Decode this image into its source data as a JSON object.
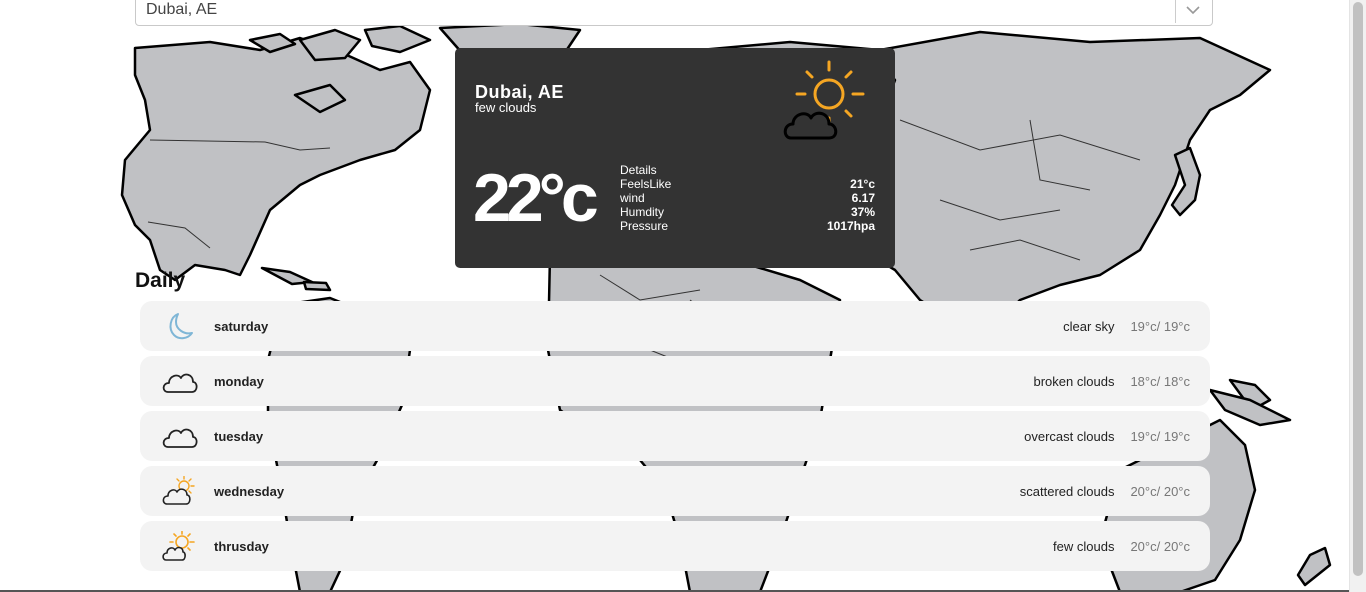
{
  "search": {
    "value": "Dubai, AE"
  },
  "current": {
    "city": "Dubai, AE",
    "description": "few clouds",
    "temperature": "22°c",
    "icon": "sun-cloud-icon",
    "details_label": "Details",
    "details": [
      {
        "label": "FeelsLike",
        "value": "21°c"
      },
      {
        "label": "wind",
        "value": "6.17"
      },
      {
        "label": "Humdity",
        "value": "37%"
      },
      {
        "label": "Pressure",
        "value": "1017hpa"
      }
    ]
  },
  "daily_title": "Daily",
  "daily": [
    {
      "day": "saturday",
      "description": "clear sky",
      "range": "19°c/ 19°c",
      "icon": "moon-icon"
    },
    {
      "day": "monday",
      "description": "broken clouds",
      "range": "18°c/ 18°c",
      "icon": "cloud-icon"
    },
    {
      "day": "tuesday",
      "description": "overcast clouds",
      "range": "19°c/ 19°c",
      "icon": "cloud-icon"
    },
    {
      "day": "wednesday",
      "description": "scattered clouds",
      "range": "20°c/ 20°c",
      "icon": "sun-cloud-icon"
    },
    {
      "day": "thrusday",
      "description": "few clouds",
      "range": "20°c/ 20°c",
      "icon": "sun-cloud-icon"
    }
  ],
  "colors": {
    "card_bg": "#333333",
    "sun": "#f5a623",
    "moon": "#7fb6d6",
    "land": "#c0c1c4",
    "row_bg": "#f3f3f3"
  }
}
